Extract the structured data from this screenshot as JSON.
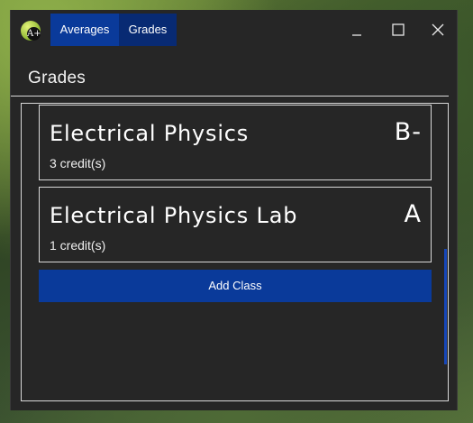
{
  "app": {
    "icon_text": "A+"
  },
  "tabs": [
    {
      "label": "Averages"
    },
    {
      "label": "Grades"
    }
  ],
  "page": {
    "title": "Grades"
  },
  "classes": [
    {
      "name": "Electrical Physics",
      "grade": "B-",
      "credits": "3 credit(s)"
    },
    {
      "name": "Electrical Physics Lab",
      "grade": "A",
      "credits": "1 credit(s)"
    }
  ],
  "actions": {
    "add_class_label": "Add Class"
  },
  "colors": {
    "accent": "#0a3a9a",
    "selected_tab": "#082a73",
    "window_bg": "#262626",
    "scrollbar": "#1747b8"
  }
}
